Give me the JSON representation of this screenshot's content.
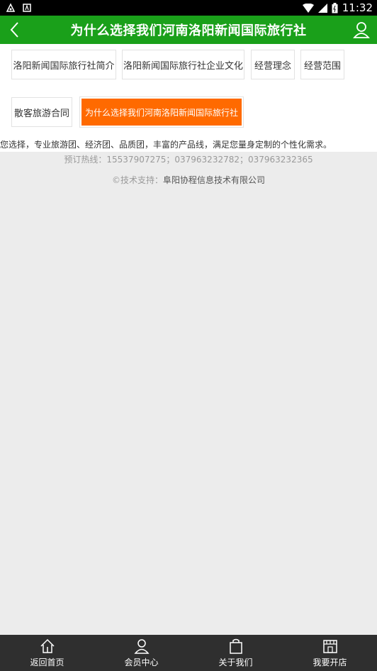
{
  "status_bar": {
    "time": "11:32",
    "icons": [
      "notification-icon",
      "android-icon",
      "wifi-icon",
      "signal-icon",
      "battery-icon"
    ]
  },
  "header": {
    "title": "为什么选择我们河南洛阳新闻国际旅行社",
    "bg_color": "#1aa01a"
  },
  "tabs": [
    {
      "label": "洛阳新闻国际旅行社简介",
      "active": false
    },
    {
      "label": "洛阳新闻国际旅行社企业文化",
      "active": false
    },
    {
      "label": "经营理念",
      "active": false
    },
    {
      "label": "经营范围",
      "active": false
    },
    {
      "label": "散客旅游合同",
      "active": false
    },
    {
      "label": "为什么选择我们河南洛阳新闻国际旅行社",
      "active": true
    }
  ],
  "article": {
    "text": "您选择，专业旅游团、经济团、品质团，丰富的产品线，满足您量身定制的个性化需求。"
  },
  "footer": {
    "hotline": "预订热线：15537907275；037963232782；037963232365",
    "support_prefix": "©技术支持：",
    "support_company": "阜阳协程信息技术有限公司"
  },
  "bottom_nav": [
    {
      "label": "返回首页",
      "icon": "home-icon"
    },
    {
      "label": "会员中心",
      "icon": "user-icon"
    },
    {
      "label": "关于我们",
      "icon": "bag-icon"
    },
    {
      "label": "我要开店",
      "icon": "shop-icon"
    }
  ],
  "colors": {
    "accent_orange": "#ff6a00",
    "header_green": "#1aa01a",
    "nav_bg": "#2f2f2f"
  }
}
